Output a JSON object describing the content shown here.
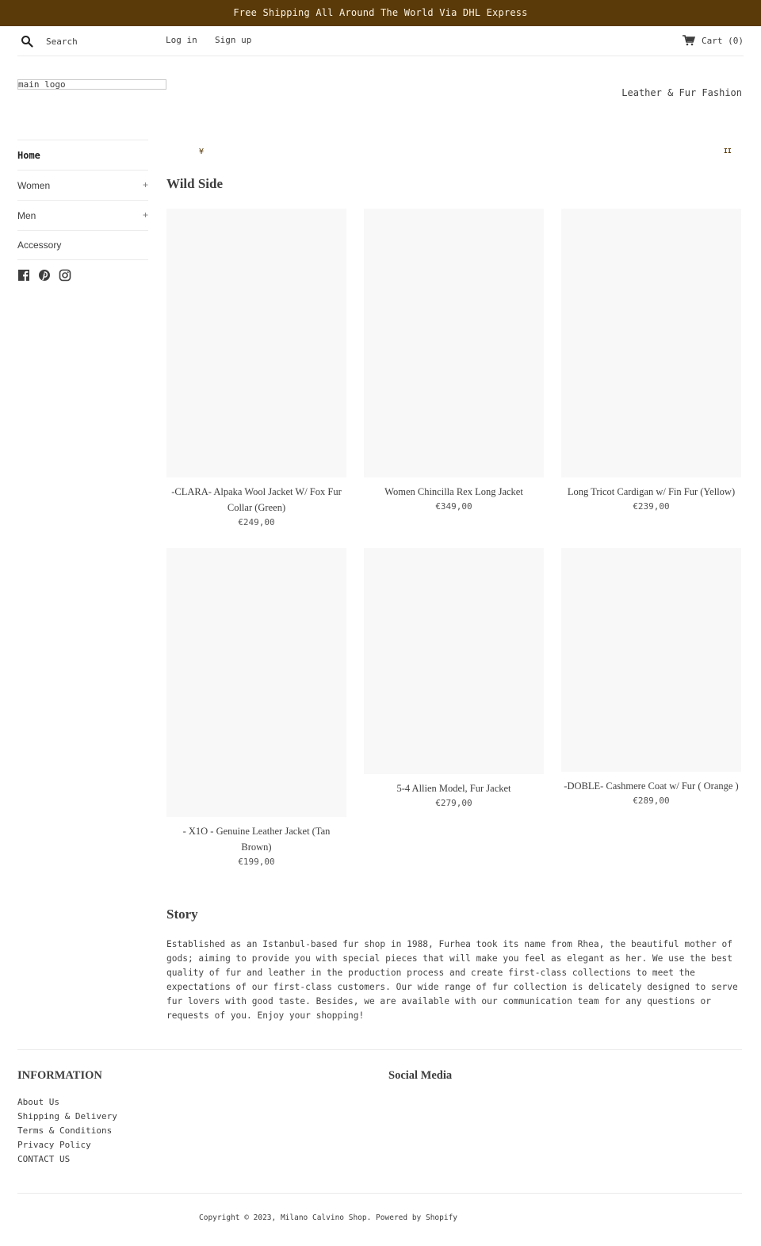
{
  "announcement": "Free Shipping All Around The World Via DHL Express",
  "header": {
    "search_placeholder": "Search",
    "login": "Log in",
    "signup": "Sign up",
    "cart": "Cart (0)",
    "logo_alt": "main logo",
    "tagline": "Leather & Fur Fashion"
  },
  "sidebar": {
    "items": [
      {
        "label": "Home",
        "active": true,
        "expandable": false
      },
      {
        "label": "Women",
        "expandable": true,
        "expand_symbol": "+"
      },
      {
        "label": "Men",
        "expandable": true,
        "expand_symbol": "+"
      },
      {
        "label": "Accessory",
        "expandable": false
      }
    ],
    "social": [
      "facebook-icon",
      "pinterest-icon",
      "instagram-icon"
    ]
  },
  "slideshow": {
    "left_marker": "¥",
    "pause_symbol": "II"
  },
  "collection": {
    "title": "Wild Side",
    "products": [
      {
        "title": "-CLARA- Alpaka Wool Jacket W/ Fox Fur Collar (Green)",
        "price": "€249,00"
      },
      {
        "title": "Women Chincilla Rex Long Jacket",
        "price": "€349,00"
      },
      {
        "title": "Long Tricot Cardigan w/ Fin Fur (Yellow)",
        "price": "€239,00"
      },
      {
        "title": "- X1O - Genuine Leather Jacket (Tan Brown)",
        "price": "€199,00"
      },
      {
        "title": "5-4 Allien Model, Fur Jacket",
        "price": "€279,00"
      },
      {
        "title": "-DOBLE- Cashmere Coat w/ Fur ( Orange )",
        "price": "€289,00"
      }
    ]
  },
  "story": {
    "title": "Story",
    "text": "Established as an Istanbul-based fur shop in 1988, Furhea took its name from Rhea, the beautiful mother of gods; aiming to provide you with special pieces that will make you feel as elegant as her. We use the best quality of fur and leather in the production process and create first-class collections to meet the expectations of our first-class customers. Our wide range of fur collection is delicately designed to serve fur lovers with good taste. Besides, we are available with our communication team for any questions or requests of you. Enjoy your shopping!"
  },
  "footer": {
    "info_title": "INFORMATION",
    "social_title": "Social Media",
    "links": [
      "About Us",
      "Shipping & Delivery",
      "Terms & Conditions",
      "Privacy Policy",
      "CONTACT US"
    ],
    "copyright": "Copyright © 2023, Milano Calvino Shop. Powered by Shopify"
  },
  "colors": {
    "announcement_bg": "#5a3a08",
    "announcement_text": "#fbf3e4",
    "image_placeholder": "#f8f8f8",
    "text": "#3d3d3d"
  }
}
